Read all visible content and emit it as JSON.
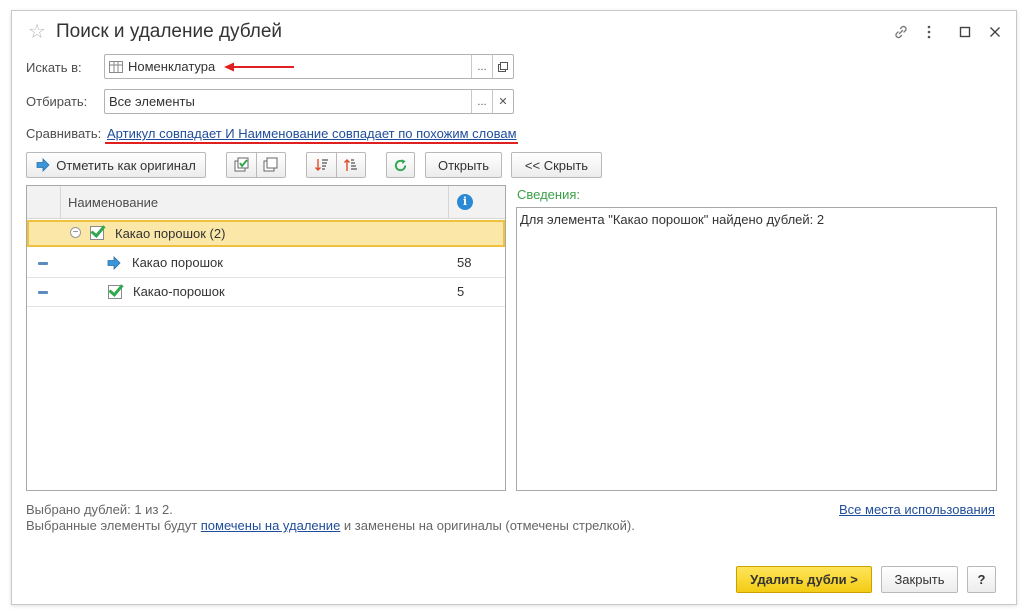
{
  "window": {
    "title": "Поиск и удаление дублей"
  },
  "search_in": {
    "label": "Искать в:",
    "value": "Номенклатура"
  },
  "filter": {
    "label": "Отбирать:",
    "value": "Все элементы"
  },
  "compare": {
    "label": "Сравнивать:",
    "link": "Артикул совпадает И Наименование совпадает по похожим словам"
  },
  "toolbar": {
    "mark_original": "Отметить как оригинал",
    "open": "Открыть",
    "hide": "<< Скрыть"
  },
  "table": {
    "columns": [
      "Наименование",
      ""
    ],
    "group": {
      "label": "Какао порошок (2)",
      "checked": true
    },
    "rows": [
      {
        "name": "Какао порошок",
        "count": "58",
        "marker": "original-arrow"
      },
      {
        "name": "Какао-порошок",
        "count": "5",
        "marker": "checkbox-checked"
      }
    ]
  },
  "details": {
    "label": "Сведения:",
    "text": "Для элемента \"Какао порошок\" найдено дублей: 2"
  },
  "footer": {
    "selected": "Выбрано дублей: 1 из 2.",
    "note_prefix": "Выбранные элементы будут ",
    "note_link": "помечены на удаление",
    "note_suffix": " и заменены на оригиналы (отмечены стрелкой).",
    "usage_link": "Все места использования"
  },
  "actions": {
    "delete": "Удалить дубли >",
    "close": "Закрыть",
    "help": "?"
  },
  "colors": {
    "accent": "#f3cc14",
    "link": "#1f4d9a",
    "highlight_row": "#fbe8a8",
    "annotation_red": "#e02020"
  }
}
